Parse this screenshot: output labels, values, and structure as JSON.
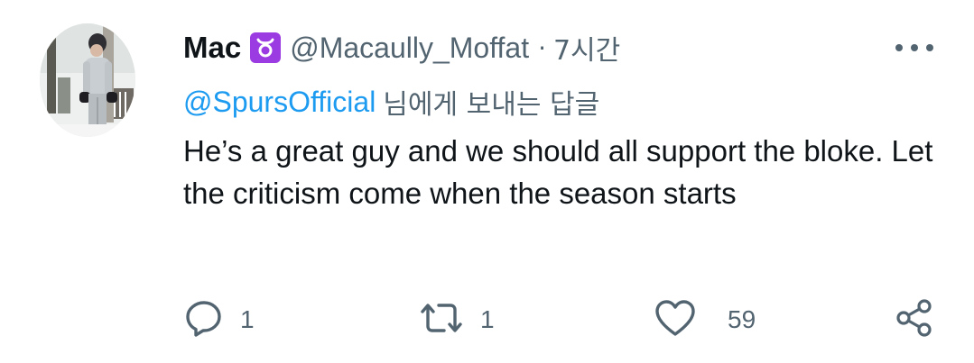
{
  "tweet": {
    "author": {
      "name": "Mac",
      "badge_icon": "taurus-zodiac-icon",
      "badge_color": "#9b3ce2",
      "handle": "@Macaully_Moffat",
      "separator": "·",
      "time": "7시간"
    },
    "reply_to": {
      "mention": "@SpursOfficial",
      "suffix": "님에게 보내는 답글"
    },
    "text": "He’s a great guy and we should all support the bloke. Let the criticism come when the season starts",
    "actions": {
      "reply_count": "1",
      "retweet_count": "1",
      "like_count": "59"
    }
  },
  "colors": {
    "primary_text": "#0f1419",
    "secondary_text": "#536471",
    "link": "#1d9bf0"
  }
}
